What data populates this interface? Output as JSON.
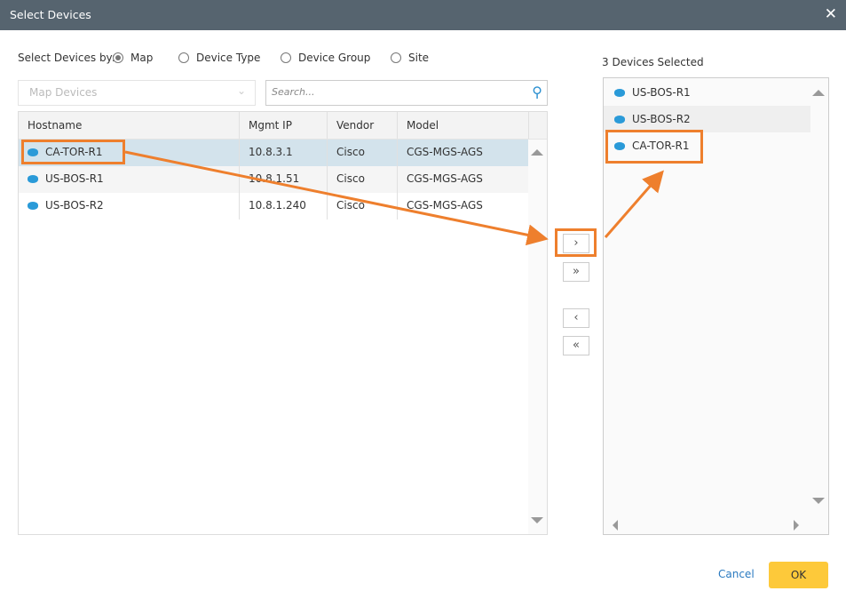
{
  "dialog": {
    "title": "Select Devices",
    "close_icon": "close-icon"
  },
  "select_by": {
    "label": "Select Devices by:",
    "options": [
      "Map",
      "Device Type",
      "Device Group",
      "Site"
    ],
    "selected": "Map"
  },
  "dropdown": {
    "value": "Map Devices"
  },
  "search": {
    "placeholder": "Search..."
  },
  "table": {
    "columns": [
      "Hostname",
      "Mgmt IP",
      "Vendor",
      "Model"
    ],
    "rows": [
      [
        "CA-TOR-R1",
        "10.8.3.1",
        "Cisco",
        "CGS-MGS-AGS"
      ],
      [
        "US-BOS-R1",
        "10.8.1.51",
        "Cisco",
        "CGS-MGS-AGS"
      ],
      [
        "US-BOS-R2",
        "10.8.1.240",
        "Cisco",
        "CGS-MGS-AGS"
      ]
    ],
    "selected_row": 0
  },
  "move_buttons": {
    "add": "›",
    "add_all": "»",
    "remove": "‹",
    "remove_all": "«"
  },
  "selected": {
    "count_label": "3 Devices Selected",
    "items": [
      "US-BOS-R1",
      "US-BOS-R2",
      "CA-TOR-R1"
    ]
  },
  "footer": {
    "cancel": "Cancel",
    "ok": "OK"
  },
  "colors": {
    "accent": "#ee7f2d",
    "titlebar": "#56646f",
    "ok": "#fdc93a",
    "row_selected": "#d3e3ec"
  }
}
